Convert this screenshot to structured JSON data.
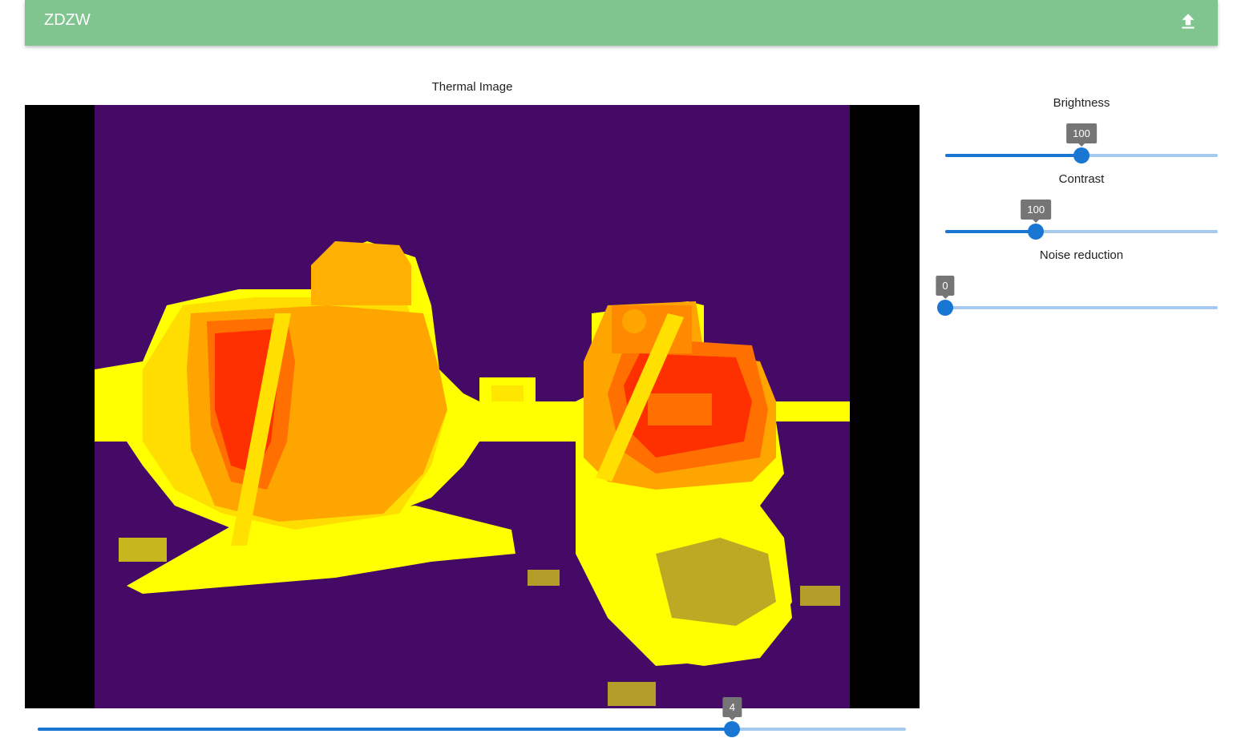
{
  "app": {
    "title": "ZDZW"
  },
  "icons": {
    "upload": "upload-icon"
  },
  "colors": {
    "appbar": "#80c590",
    "slider": "#1976d2",
    "slider_rail": "#a6c9ee",
    "thermal_bg": "#440a66"
  },
  "image": {
    "title": "Thermal Image"
  },
  "controls": [
    {
      "key": "brightness",
      "label": "Brightness",
      "value": "100",
      "fraction": 0.5
    },
    {
      "key": "contrast",
      "label": "Contrast",
      "value": "100",
      "fraction": 0.333
    },
    {
      "key": "noise",
      "label": "Noise reduction",
      "value": "0",
      "fraction": 0.0
    }
  ],
  "bottom_slider": {
    "value": "4",
    "fraction": 0.8
  }
}
